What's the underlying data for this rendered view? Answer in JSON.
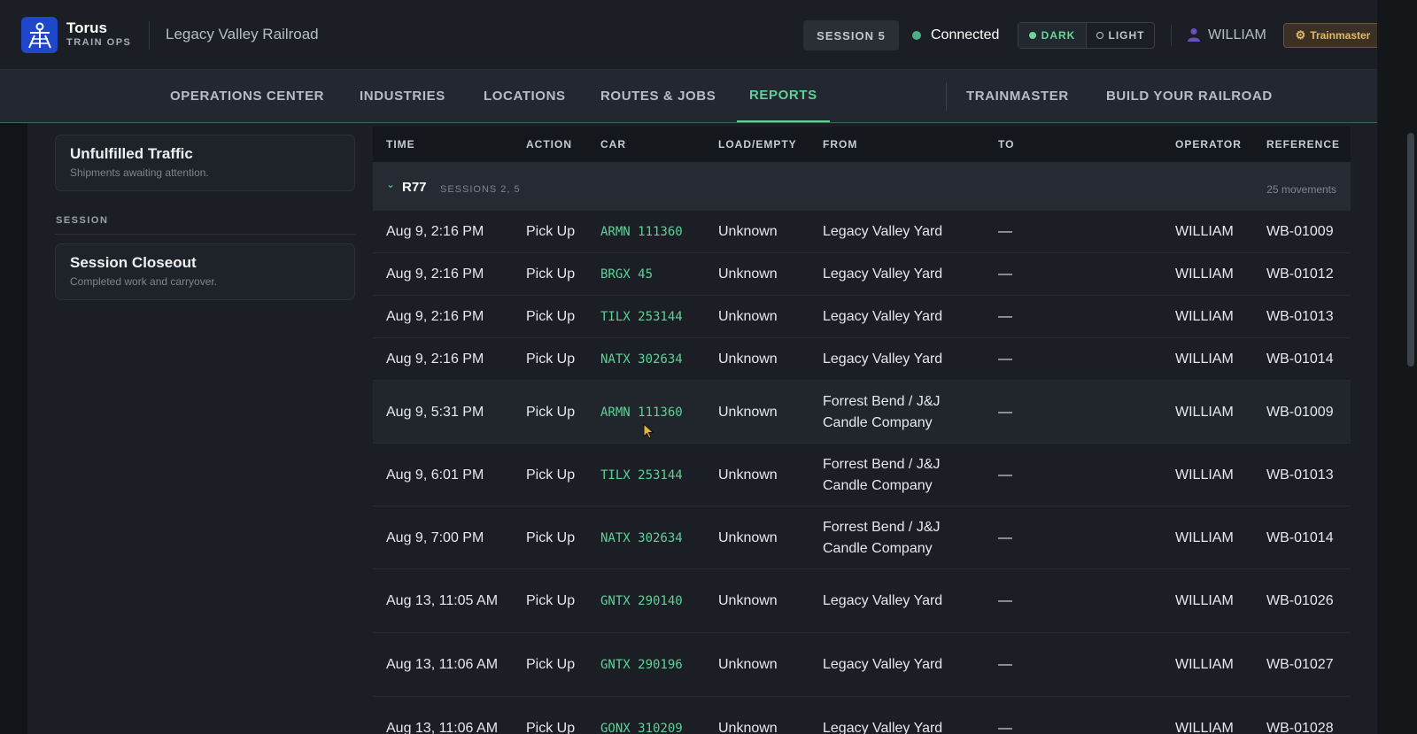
{
  "header": {
    "brand_name": "Torus",
    "brand_sub": "TRAIN OPS",
    "railroad_name": "Legacy Valley Railroad",
    "session_label": "SESSION 5",
    "connection_status": "Connected",
    "theme": {
      "dark_label": "DARK",
      "light_label": "LIGHT"
    },
    "user_name": "WILLIAM",
    "role_label": "Trainmaster"
  },
  "nav": {
    "items": [
      {
        "label": "OPERATIONS CENTER"
      },
      {
        "label": "INDUSTRIES"
      },
      {
        "label": "LOCATIONS"
      },
      {
        "label": "ROUTES & JOBS"
      },
      {
        "label": "REPORTS"
      },
      {
        "label": "TRAINMASTER"
      },
      {
        "label": "BUILD YOUR RAILROAD"
      }
    ],
    "active": "REPORTS"
  },
  "sidebar": {
    "cards": [
      {
        "title": "Unfulfilled Traffic",
        "subtitle": "Shipments awaiting attention."
      },
      {
        "title": "Session Closeout",
        "subtitle": "Completed work and carryover."
      }
    ],
    "section_label": "SESSION"
  },
  "table": {
    "columns": [
      "TIME",
      "ACTION",
      "CAR",
      "LOAD/EMPTY",
      "FROM",
      "TO",
      "OPERATOR",
      "REFERENCE"
    ],
    "group": {
      "name": "R77",
      "sessions": "SESSIONS 2, 5",
      "count": "25 movements"
    },
    "rows": [
      {
        "time": "Aug 9, 2:16 PM",
        "action": "Pick Up",
        "car": "ARMN 111360",
        "load": "Unknown",
        "from": "Legacy Valley Yard",
        "to": "—",
        "operator": "WILLIAM",
        "reference": "WB-01009"
      },
      {
        "time": "Aug 9, 2:16 PM",
        "action": "Pick Up",
        "car": "BRGX 45",
        "load": "Unknown",
        "from": "Legacy Valley Yard",
        "to": "—",
        "operator": "WILLIAM",
        "reference": "WB-01012"
      },
      {
        "time": "Aug 9, 2:16 PM",
        "action": "Pick Up",
        "car": "TILX 253144",
        "load": "Unknown",
        "from": "Legacy Valley Yard",
        "to": "—",
        "operator": "WILLIAM",
        "reference": "WB-01013"
      },
      {
        "time": "Aug 9, 2:16 PM",
        "action": "Pick Up",
        "car": "NATX 302634",
        "load": "Unknown",
        "from": "Legacy Valley Yard",
        "to": "—",
        "operator": "WILLIAM",
        "reference": "WB-01014"
      },
      {
        "time": "Aug 9, 5:31 PM",
        "action": "Pick Up",
        "car": "ARMN 111360",
        "load": "Unknown",
        "from": "Forrest Bend / J&J Candle Company",
        "to": "—",
        "operator": "WILLIAM",
        "reference": "WB-01009"
      },
      {
        "time": "Aug 9, 6:01 PM",
        "action": "Pick Up",
        "car": "TILX 253144",
        "load": "Unknown",
        "from": "Forrest Bend / J&J Candle Company",
        "to": "—",
        "operator": "WILLIAM",
        "reference": "WB-01013"
      },
      {
        "time": "Aug 9, 7:00 PM",
        "action": "Pick Up",
        "car": "NATX 302634",
        "load": "Unknown",
        "from": "Forrest Bend / J&J Candle Company",
        "to": "—",
        "operator": "WILLIAM",
        "reference": "WB-01014"
      },
      {
        "time": "Aug 13, 11:05 AM",
        "action": "Pick Up",
        "car": "GNTX 290140",
        "load": "Unknown",
        "from": "Legacy Valley Yard",
        "to": "—",
        "operator": "WILLIAM",
        "reference": "WB-01026"
      },
      {
        "time": "Aug 13, 11:06 AM",
        "action": "Pick Up",
        "car": "GNTX 290196",
        "load": "Unknown",
        "from": "Legacy Valley Yard",
        "to": "—",
        "operator": "WILLIAM",
        "reference": "WB-01027"
      },
      {
        "time": "Aug 13, 11:06 AM",
        "action": "Pick Up",
        "car": "GONX 310209",
        "load": "Unknown",
        "from": "Legacy Valley Yard",
        "to": "—",
        "operator": "WILLIAM",
        "reference": "WB-01028"
      }
    ]
  },
  "colors": {
    "accent": "#5fd096",
    "role_badge": "#e2b86b",
    "logo_bg": "#1f47c9"
  }
}
